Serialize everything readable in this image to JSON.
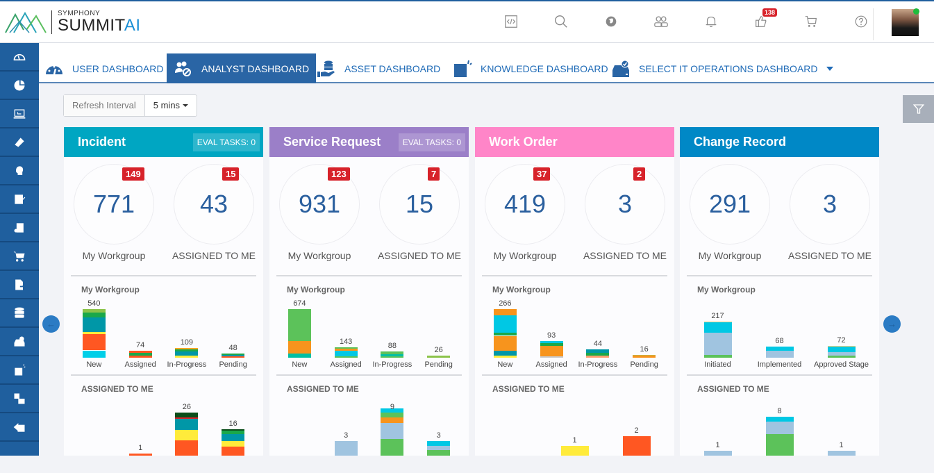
{
  "header": {
    "logo_small": "SYMPHONY",
    "logo_main": "SUMMIT",
    "logo_ai": "AI",
    "icons": [
      {
        "name": "code-icon"
      },
      {
        "name": "search-icon"
      },
      {
        "name": "globe-icon"
      },
      {
        "name": "users-icon"
      },
      {
        "name": "bell-icon"
      },
      {
        "name": "thumbs-up-icon",
        "badge": "138"
      },
      {
        "name": "cart-icon"
      },
      {
        "name": "help-icon"
      }
    ],
    "status_color": "#1ebc3c"
  },
  "sidebar": {
    "items": [
      "dashboard-icon",
      "pie-chart-icon",
      "monitor-icon",
      "ticket-icon",
      "support-agent-icon",
      "edit-document-icon",
      "clipboard-settings-icon",
      "shopping-cart-icon",
      "document-export-icon",
      "database-icon",
      "drive-check-icon",
      "knowledge-icon",
      "puzzle-icon",
      "list-back-icon"
    ]
  },
  "tabs": [
    {
      "label": "USER DASHBOARD",
      "active": false
    },
    {
      "label": "ANALYST DASHBOARD",
      "active": true
    },
    {
      "label": "ASSET DASHBOARD",
      "active": false
    },
    {
      "label": "KNOWLEDGE DASHBOARD",
      "active": false
    },
    {
      "label": "SELECT IT OPERATIONS DASHBOARD",
      "active": false
    }
  ],
  "refresh": {
    "label": "Refresh Interval",
    "value": "5 mins"
  },
  "cards": [
    {
      "title": "Incident",
      "color": "#00a6c2",
      "eval": "EVAL TASKS: 0",
      "workgroup": {
        "value": "771",
        "badge": "149",
        "label": "My Workgroup"
      },
      "assigned": {
        "value": "43",
        "badge": "15",
        "label": "ASSIGNED TO ME"
      },
      "wg_title": "My Workgroup",
      "am_title": "ASSIGNED TO ME"
    },
    {
      "title": "Service Request",
      "color": "#9b7fc8",
      "eval": "EVAL TASKS: 0",
      "workgroup": {
        "value": "931",
        "badge": "123",
        "label": "My Workgroup"
      },
      "assigned": {
        "value": "15",
        "badge": "7",
        "label": "ASSIGNED TO ME"
      },
      "wg_title": "My Workgroup",
      "am_title": "ASSIGNED TO ME"
    },
    {
      "title": "Work Order",
      "color": "#ff85c8",
      "eval": null,
      "workgroup": {
        "value": "419",
        "badge": "37",
        "label": "My Workgroup"
      },
      "assigned": {
        "value": "3",
        "badge": "2",
        "label": "ASSIGNED TO ME"
      },
      "wg_title": "My Workgroup",
      "am_title": "ASSIGNED TO ME"
    },
    {
      "title": "Change Record",
      "color": "#0088c6",
      "eval": null,
      "workgroup": {
        "value": "291",
        "badge": null,
        "label": "My Workgroup"
      },
      "assigned": {
        "value": "3",
        "badge": null,
        "label": "ASSIGNED TO ME"
      },
      "wg_title": "My Workgroup",
      "am_title": "ASSIGNED TO ME"
    }
  ],
  "chart_data": [
    {
      "type": "bar",
      "title": "Incident - My Workgroup",
      "categories": [
        "New",
        "Assigned",
        "In-Progress",
        "Pending"
      ],
      "values": [
        540,
        74,
        109,
        48
      ],
      "segments": [
        [
          [
            "#00cfe8",
            0.15
          ],
          [
            "#ff5722",
            0.33
          ],
          [
            "#ffeb3b",
            0.05
          ],
          [
            "#0097a7",
            0.3
          ],
          [
            "#1aa84a",
            0.1
          ],
          [
            "#8bc34a",
            0.07
          ]
        ],
        [
          [
            "#ff5722",
            0.3
          ],
          [
            "#1aa84a",
            0.4
          ],
          [
            "#ff5722",
            0.3
          ]
        ],
        [
          [
            "#ffeb3b",
            0.2
          ],
          [
            "#0097a7",
            0.45
          ],
          [
            "#1aa84a",
            0.2
          ],
          [
            "#f6a623",
            0.15
          ]
        ],
        [
          [
            "#ff5722",
            0.4
          ],
          [
            "#0097a7",
            0.3
          ],
          [
            "#1aa84a",
            0.3
          ]
        ]
      ]
    },
    {
      "type": "bar",
      "title": "Service Request - My Workgroup",
      "categories": [
        "New",
        "Assigned",
        "In-Progress",
        "Pending"
      ],
      "values": [
        674,
        143,
        88,
        26
      ],
      "segments": [
        [
          [
            "#00bfa5",
            0.08
          ],
          [
            "#f7941d",
            0.27
          ],
          [
            "#5cc25a",
            0.65
          ]
        ],
        [
          [
            "#5cc25a",
            0.15
          ],
          [
            "#00c8e4",
            0.55
          ],
          [
            "#f7941d",
            0.15
          ],
          [
            "#5cc25a",
            0.15
          ]
        ],
        [
          [
            "#5cc25a",
            0.25
          ],
          [
            "#00bfa5",
            0.25
          ],
          [
            "#5cc25a",
            0.5
          ]
        ],
        [
          [
            "#8bc34a",
            1.0
          ]
        ]
      ]
    },
    {
      "type": "bar",
      "title": "Work Order - My Workgroup",
      "categories": [
        "New",
        "Assigned",
        "In-Progress",
        "Pending"
      ],
      "values": [
        266,
        93,
        44,
        16
      ],
      "segments": [
        [
          [
            "#ffeb3b",
            0.05
          ],
          [
            "#0097a7",
            0.1
          ],
          [
            "#f7941d",
            0.3
          ],
          [
            "#1aa84a",
            0.07
          ],
          [
            "#00c8e4",
            0.2
          ],
          [
            "#00c8e4",
            0.15
          ],
          [
            "#f7941d",
            0.13
          ]
        ],
        [
          [
            "#c8c8c8",
            0.1
          ],
          [
            "#f7941d",
            0.6
          ],
          [
            "#1aa84a",
            0.15
          ],
          [
            "#00c8e4",
            0.15
          ]
        ],
        [
          [
            "#ff9f70",
            0.3
          ],
          [
            "#1aa84a",
            0.3
          ],
          [
            "#0097a7",
            0.4
          ]
        ],
        [
          [
            "#f7941d",
            0.6
          ],
          [
            "#c8b040",
            0.4
          ]
        ]
      ]
    },
    {
      "type": "bar",
      "title": "Change Record - My Workgroup",
      "categories": [
        "Initiated",
        "Implemented",
        "Approved Stage"
      ],
      "values": [
        217,
        68,
        72
      ],
      "segments": [
        [
          [
            "#5cc25a",
            0.08
          ],
          [
            "#a0c4e0",
            0.62
          ],
          [
            "#00c8e4",
            0.28
          ],
          [
            "#f6d07a",
            0.02
          ]
        ],
        [
          [
            "#a0c4e0",
            0.6
          ],
          [
            "#00c8e4",
            0.4
          ]
        ],
        [
          [
            "#5cc25a",
            0.15
          ],
          [
            "#a0c4e0",
            0.3
          ],
          [
            "#00c8e4",
            0.5
          ],
          [
            "#f6d07a",
            0.05
          ]
        ]
      ]
    },
    {
      "type": "bar",
      "title": "Incident - Assigned To Me",
      "categories": [
        "",
        "",
        "",
        ""
      ],
      "values": [
        0,
        1,
        26,
        16
      ],
      "segments": [
        [],
        [
          [
            "#ff5722",
            1
          ]
        ],
        [
          [
            "#ff5722",
            0.35
          ],
          [
            "#ffeb3b",
            0.25
          ],
          [
            "#0097a7",
            0.25
          ],
          [
            "#d7222a",
            0.03
          ],
          [
            "#0b4d1a",
            0.12
          ]
        ],
        [
          [
            "#ff5722",
            0.35
          ],
          [
            "#ffeb3b",
            0.2
          ],
          [
            "#0097a7",
            0.25
          ],
          [
            "#1aa84a",
            0.15
          ],
          [
            "#0b4d1a",
            0.05
          ]
        ]
      ]
    },
    {
      "type": "bar",
      "title": "Service Request - Assigned To Me",
      "categories": [
        "",
        "",
        "",
        ""
      ],
      "values": [
        0,
        3,
        9,
        3
      ],
      "segments": [
        [],
        [
          [
            "#a0c4e0",
            1
          ]
        ],
        [
          [
            "#5cc25a",
            0.38
          ],
          [
            "#a0c4e0",
            0.38
          ],
          [
            "#f7941d",
            0.12
          ],
          [
            "#5cc25a",
            0.12
          ],
          [
            "#00c8e4",
            0.1
          ]
        ],
        [
          [
            "#5cc25a",
            0.4
          ],
          [
            "#a0c4e0",
            0.3
          ],
          [
            "#00c8e4",
            0.3
          ]
        ]
      ]
    },
    {
      "type": "bar",
      "title": "Work Order - Assigned To Me",
      "categories": [
        "",
        "",
        ""
      ],
      "values": [
        0,
        1,
        2
      ],
      "segments": [
        [],
        [
          [
            "#ffeb3b",
            1
          ]
        ],
        [
          [
            "#ff5722",
            1
          ]
        ]
      ]
    },
    {
      "type": "bar",
      "title": "Change Record - Assigned To Me",
      "categories": [
        "",
        "",
        ""
      ],
      "values": [
        1,
        8,
        1
      ],
      "segments": [
        [
          [
            "#a0c4e0",
            1
          ]
        ],
        [
          [
            "#5cc25a",
            0.55
          ],
          [
            "#a0c4e0",
            0.33
          ],
          [
            "#00c8e4",
            0.12
          ]
        ],
        [
          [
            "#a0c4e0",
            1
          ]
        ]
      ]
    }
  ]
}
